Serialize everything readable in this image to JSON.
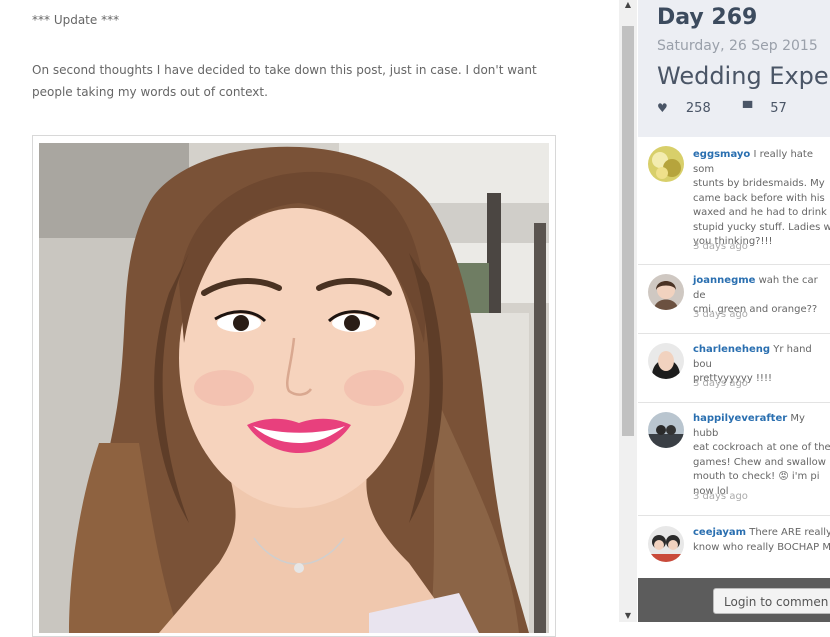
{
  "article": {
    "update_heading": "*** Update ***",
    "update_line1": "On second thoughts I have decided to take down this post, just in case. I don't want",
    "update_line2": "people taking my words out of context."
  },
  "panel": {
    "day": "Day 269",
    "date": "Saturday, 26 Sep 2015",
    "title": "Wedding Expect",
    "likes": "258",
    "comments_count": "57",
    "like_icon": "heart-icon",
    "comment_icon": "speech-bubble-icon",
    "comments": [
      {
        "user": "eggsmayo",
        "lines": [
          " I really hate som",
          "stunts by bridesmaids. My",
          "came back before with his",
          "waxed and he had to drink",
          "stupid yucky stuff. Ladies w",
          "you thinking?!!!"
        ],
        "time": "3 days ago"
      },
      {
        "user": "joannegme",
        "lines": [
          " wah the car de",
          "cmi. green and orange??"
        ],
        "time": "3 days ago"
      },
      {
        "user": "charleneheng",
        "lines": [
          " Yr hand bou",
          "prettyyyyyy !!!!"
        ],
        "time": "3 days ago"
      },
      {
        "user": "happilyeverafter",
        "lines": [
          " My hubb",
          "eat cockroach at one of the",
          "games! Chew and swallow",
          "mouth to check! 😡 i'm pi",
          "now lol"
        ],
        "time": "3 days ago"
      },
      {
        "user": "ceejayam",
        "lines": [
          " There ARE really",
          "know who really BOCHAP M"
        ],
        "time": ""
      }
    ],
    "login_label": "Login to commen"
  },
  "colors": {
    "panel_header_bg": "#eceef3",
    "title_color": "#3c4b5e",
    "username_color": "#2a6fb0",
    "footer_bg": "#5c5c5c"
  }
}
